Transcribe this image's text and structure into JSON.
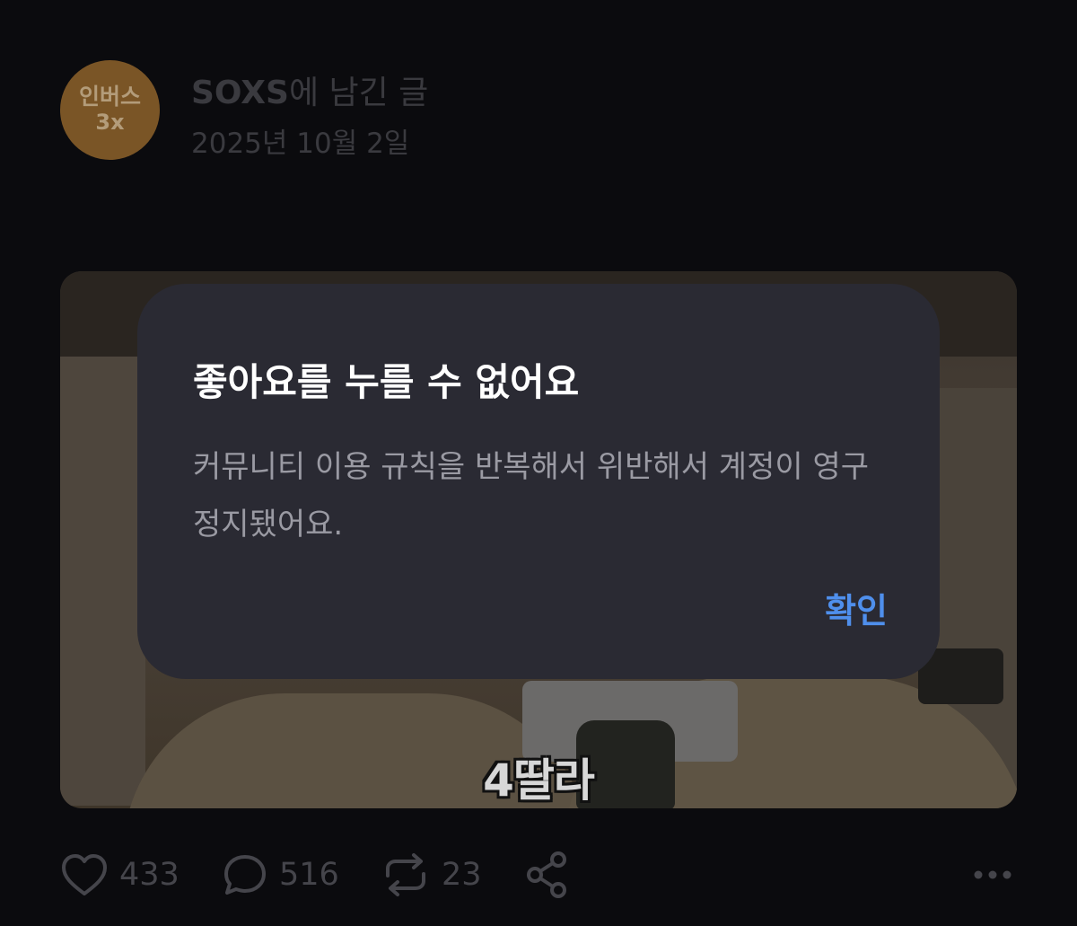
{
  "post": {
    "avatar_text_line1": "인버스",
    "avatar_text_line2": "3x",
    "title_bold": "SOXS",
    "title_suffix": "에 남긴 글",
    "date": "2025년 10월 2일"
  },
  "media": {
    "subtitle": "4딸라"
  },
  "modal": {
    "title": "좋아요를 누를 수 없어요",
    "body": "커뮤니티 이용 규칙을 반복해서 위반해서 계정이 영구 정지됐어요.",
    "confirm_label": "확인"
  },
  "actions": {
    "likes": "433",
    "comments": "516",
    "reposts": "23"
  },
  "icons": [
    "heart-icon",
    "comment-icon",
    "repost-icon",
    "share-icon",
    "more-icon"
  ],
  "colors": {
    "accent": "#4f8fec",
    "background": "#0b0b0e",
    "modal_background": "#2a2a33",
    "avatar_background": "#7a5526"
  }
}
